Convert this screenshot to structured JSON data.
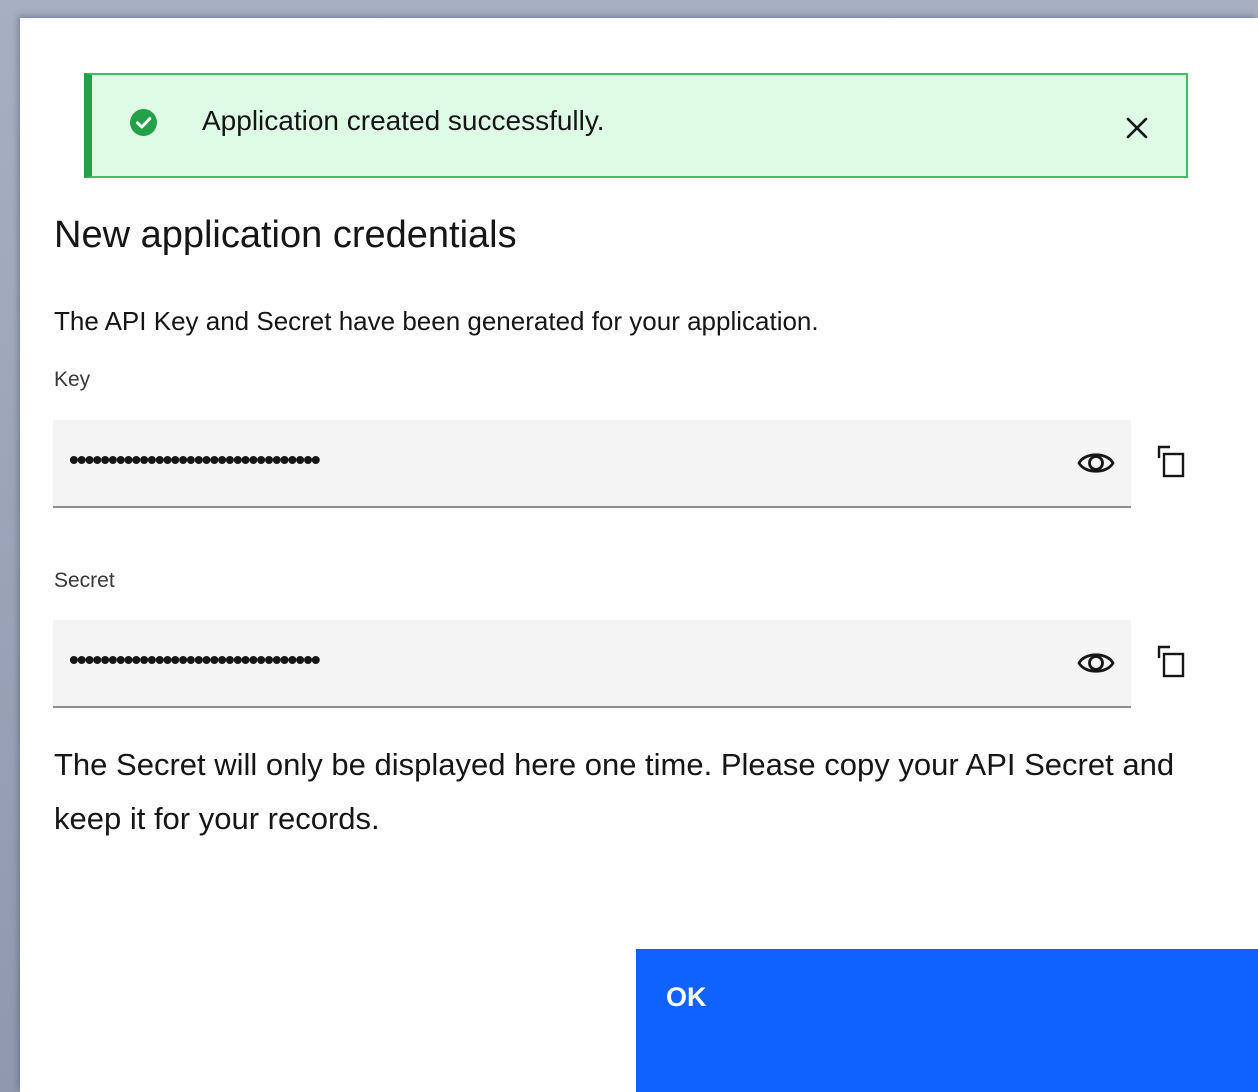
{
  "notification": {
    "message": "Application created successfully.",
    "icon": "checkmark-filled-icon",
    "close_icon": "close-icon",
    "colors": {
      "background": "#defbe6",
      "border": "#42be65",
      "accent": "#24a148"
    }
  },
  "dialog": {
    "title": "New application credentials",
    "description": "The API Key and Secret have been generated for your application.",
    "note": "The Secret will only be displayed here one time. Please copy your API Secret and keep it for your records."
  },
  "fields": {
    "key": {
      "label": "Key",
      "masked_value": "••••••••••••••••••••••••••••••••",
      "visibility_icon": "eye-icon",
      "copy_icon": "copy-icon"
    },
    "secret": {
      "label": "Secret",
      "masked_value": "••••••••••••••••••••••••••••••••",
      "visibility_icon": "eye-icon",
      "copy_icon": "copy-icon"
    }
  },
  "actions": {
    "ok_label": "OK",
    "primary_color": "#0f62fe"
  }
}
